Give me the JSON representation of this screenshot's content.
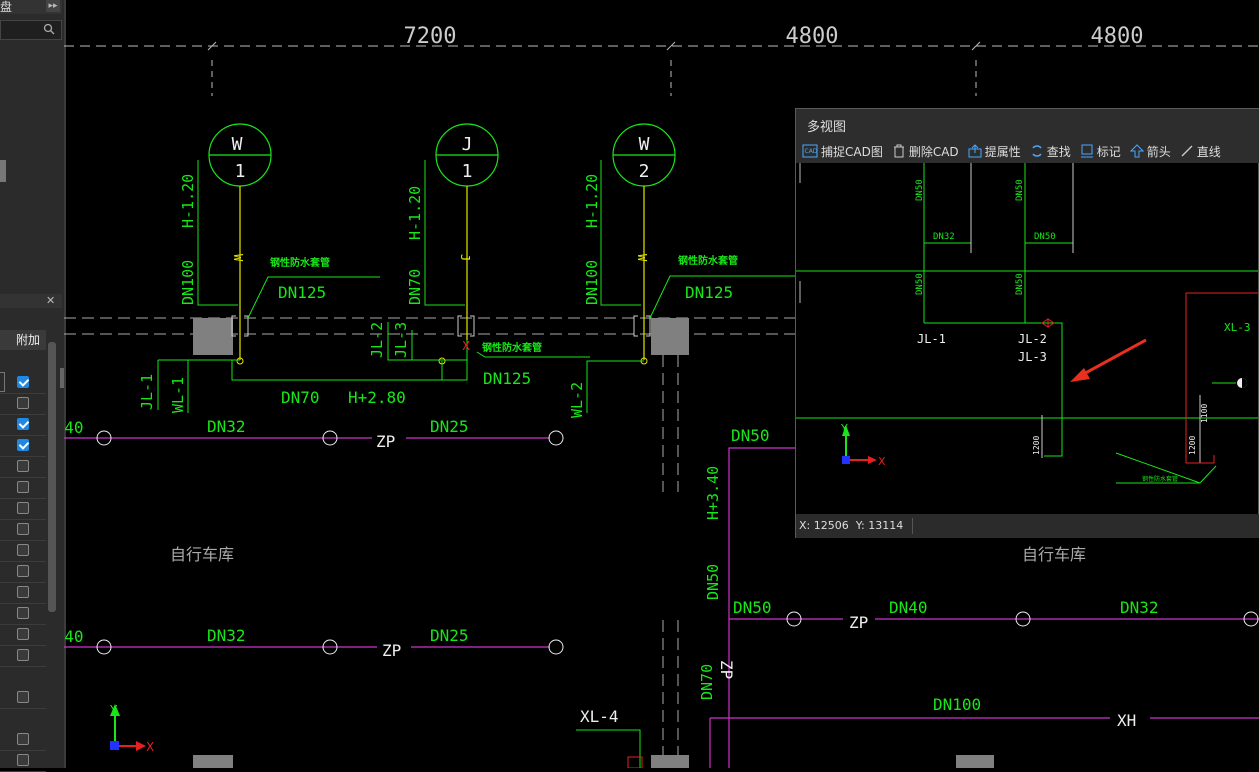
{
  "left_panel": {
    "title": "盘",
    "header": "附加",
    "checkboxes": [
      true,
      false,
      true,
      true,
      false,
      false,
      false,
      false,
      false,
      false,
      false,
      false,
      false,
      false,
      false,
      false,
      false
    ]
  },
  "drawing": {
    "dimensions": [
      "7200",
      "4800",
      "4800"
    ],
    "circles": [
      {
        "top": "W",
        "bottom": "1"
      },
      {
        "top": "J",
        "bottom": "1"
      },
      {
        "top": "W",
        "bottom": "2"
      }
    ],
    "labels": {
      "h120": "H-1.20",
      "dn100": "DN100",
      "dn70": "DN70",
      "w": "W",
      "j": "J",
      "sleeve1": "钢性防水套管",
      "sleeve2": "钢性防水套管",
      "sleeve3": "钢性防水套管",
      "dn125": "DN125",
      "jl2": "JL-2",
      "jl3": "JL-3",
      "jl1": "JL-1",
      "wl1": "WL-1",
      "wl2": "WL-2",
      "h280": "H+2.80",
      "dn40": "DN40",
      "dn32": "DN32",
      "dn25": "DN25",
      "dn50": "DN50",
      "zp": "ZP",
      "h340": "H+3.40",
      "garage": "自行车库",
      "xl4": "XL-4",
      "xh": "XH",
      "zp_v": "ZP",
      "x": "X",
      "y": "Y"
    }
  },
  "multiview": {
    "title": "多视图",
    "toolbar": [
      {
        "icon": "cad-icon",
        "label": "捕捉CAD图"
      },
      {
        "icon": "trash-icon",
        "label": "删除CAD"
      },
      {
        "icon": "extract-icon",
        "label": "提属性"
      },
      {
        "icon": "find-icon",
        "label": "查找"
      },
      {
        "icon": "mark-icon",
        "label": "标记"
      },
      {
        "icon": "arrow-up-icon",
        "label": "箭头"
      },
      {
        "icon": "line-icon",
        "label": "直线"
      }
    ],
    "labels": {
      "dn50": "DN50",
      "dn32": "DN32",
      "jl1": "JL-1",
      "jl2": "JL-2",
      "jl3": "JL-3",
      "xl3": "XL-3",
      "d1200": "1200",
      "d1100": "1100",
      "small_note": "钢性防水套管",
      "x": "X",
      "y": "Y"
    },
    "status": {
      "x": "X: 12506",
      "y": "Y: 13114"
    }
  }
}
